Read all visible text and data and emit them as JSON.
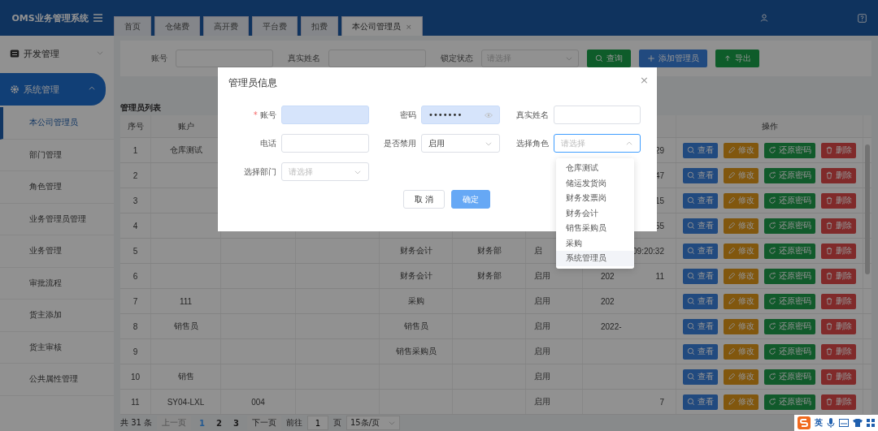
{
  "app": {
    "title": "OMS业务管理系统"
  },
  "tabs": [
    {
      "label": "首页",
      "selected": false
    },
    {
      "label": "仓储费",
      "selected": false
    },
    {
      "label": "高开费",
      "selected": false
    },
    {
      "label": "平台费",
      "selected": false
    },
    {
      "label": "扣费",
      "selected": false
    },
    {
      "label": "本公司管理员",
      "selected": true,
      "close": "×"
    }
  ],
  "sidebar": {
    "groups": [
      {
        "label": "开发管理",
        "kind": "dev",
        "expanded": false
      },
      {
        "label": "系统管理",
        "kind": "settings",
        "expanded": true,
        "children": [
          {
            "label": "本公司管理员",
            "selected": true
          },
          {
            "label": "部门管理",
            "selected": false
          },
          {
            "label": "角色管理",
            "selected": false
          },
          {
            "label": "业务管理员管理",
            "selected": false
          },
          {
            "label": "业务管理",
            "selected": false
          },
          {
            "label": "审批流程",
            "selected": false
          },
          {
            "label": "货主添加",
            "selected": false
          },
          {
            "label": "货主审核",
            "selected": false
          },
          {
            "label": "公共属性管理",
            "selected": false
          }
        ]
      }
    ]
  },
  "filters": {
    "fields": [
      {
        "label": "账号",
        "kind": "input"
      },
      {
        "label": "真实姓名",
        "kind": "input"
      },
      {
        "label": "锁定状态",
        "kind": "select",
        "placeholder": "请选择"
      }
    ],
    "buttons": [
      {
        "label": "查询",
        "kind": "search"
      },
      {
        "label": "添加管理员",
        "kind": "add"
      },
      {
        "label": "导出",
        "kind": "export"
      }
    ]
  },
  "table": {
    "title": "管理员列表",
    "columns": [
      "序号",
      "账户"
    ],
    "action_column": "操作",
    "rows": [
      {
        "index": "1",
        "account": "仓库测试",
        "column_8": {
          "tail": "29"
        },
        "actions": [
          "查看",
          "修改",
          "还原密码",
          "删除"
        ]
      },
      {
        "index": "2",
        "column_8": {
          "tail": "47"
        },
        "actions": [
          "查看",
          "修改",
          "还原密码",
          "删除"
        ]
      },
      {
        "index": "3",
        "column_8": {
          "tail": "15"
        },
        "actions": [
          "查看",
          "修改",
          "还原密码",
          "删除"
        ]
      },
      {
        "index": "4",
        "column_8": {
          "tail": "55"
        },
        "actions": [
          "查看",
          "修改",
          "还原密码",
          "删除"
        ]
      },
      {
        "index": "5",
        "column_5": "财务会计",
        "column_6": "财务部",
        "column_7": "启",
        "column_8": {
          "tail": "09:20:32"
        },
        "actions": [
          "查看",
          "修改",
          "还原密码",
          "删除"
        ]
      },
      {
        "index": "6",
        "column_5": "财务会计",
        "column_6": "财务部",
        "column_7": "启用",
        "column_8": {
          "head": "202",
          "tail": "11"
        },
        "actions": [
          "查看",
          "修改",
          "还原密码",
          "删除"
        ]
      },
      {
        "index": "7",
        "account": "111",
        "column_5": "采购",
        "column_7": "启用",
        "column_8": {
          "head": "202"
        },
        "actions": [
          "查看",
          "修改",
          "还原密码",
          "删除"
        ]
      },
      {
        "index": "8",
        "account": "销售员",
        "column_5": "销售员",
        "column_7": "启用",
        "column_8": {
          "head": "2022-"
        },
        "actions": [
          "查看",
          "修改",
          "还原密码",
          "删除"
        ]
      },
      {
        "index": "9",
        "column_5": "销售采购员",
        "column_7": "启用",
        "actions": [
          "查看",
          "修改",
          "还原密码",
          "删除"
        ]
      },
      {
        "index": "10",
        "account": "销售",
        "column_7": "启用",
        "actions": [
          "查看",
          "修改",
          "还原密码",
          "删除"
        ]
      },
      {
        "index": "11",
        "account": "SY04-LXL",
        "column_3": "004",
        "column_7": "启用",
        "column_8": {
          "tail": "7"
        },
        "actions": [
          "查看",
          "修改",
          "还原密码",
          "删除"
        ]
      }
    ]
  },
  "pagination": {
    "total": "共 31 条",
    "prev": "上一页",
    "prev_disabled": true,
    "pages": [
      {
        "label": "1",
        "selected": true
      },
      {
        "label": "2",
        "selected": false
      },
      {
        "label": "3",
        "selected": false
      }
    ],
    "next": "下一页",
    "goto_label": "前往",
    "goto_value": "1",
    "page_unit": "页",
    "page_size": "15条/页"
  },
  "modal": {
    "title": "管理员信息",
    "close": "×",
    "fields": [
      {
        "label": "账号",
        "kind": "input",
        "required_mark": "*",
        "autofilled": true
      },
      {
        "label": "密码",
        "kind": "password",
        "autofilled": true,
        "value": "•••••••"
      },
      {
        "label": "真实姓名",
        "kind": "input",
        "autofilled": false
      },
      {
        "label": "电话",
        "kind": "input",
        "autofilled": false
      },
      {
        "label": "是否禁用",
        "kind": "select",
        "value": "启用",
        "open": false
      },
      {
        "label": "选择角色",
        "kind": "select",
        "placeholder": "请选择",
        "open": true
      },
      {
        "label": "选择部门",
        "kind": "select",
        "placeholder": "请选择",
        "open": false
      }
    ],
    "buttons": [
      {
        "label": "取 消",
        "kind": "default"
      },
      {
        "label": "确定",
        "kind": "primary"
      }
    ],
    "dropdown": [
      {
        "label": "仓库测试",
        "hovered": false
      },
      {
        "label": "储运发货岗",
        "hovered": false
      },
      {
        "label": "财务发票岗",
        "hovered": false
      },
      {
        "label": "财务会计",
        "hovered": false
      },
      {
        "label": "销售采购员",
        "hovered": false
      },
      {
        "label": "采购",
        "hovered": false
      },
      {
        "label": "系统管理员",
        "hovered": true
      }
    ]
  },
  "ime": {
    "label": "英"
  }
}
